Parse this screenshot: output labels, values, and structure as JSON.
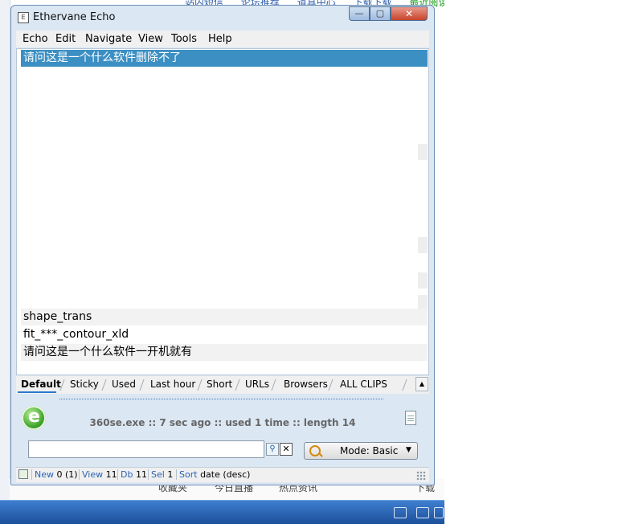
{
  "background": {
    "top_nav": [
      "站内短信",
      "论坛推荐",
      "道具中心",
      "下载下载",
      "最近阅读"
    ],
    "taskbar_items": [
      "收藏夹",
      "今日直播",
      "热点资讯",
      "下载"
    ]
  },
  "window": {
    "title": "Ethervane Echo",
    "controls": {
      "minimize": "—",
      "maximize": "▢",
      "close": "✕"
    }
  },
  "menu": [
    "Echo",
    "Edit",
    "Navigate",
    "View",
    "Tools",
    "Help"
  ],
  "clips": {
    "selected": "请问这是一个什么软件删除不了",
    "items": [
      "shape_trans",
      "fit_***_contour_xld",
      "请问这是一个什么软件一开机就有"
    ]
  },
  "tabs": [
    "Default",
    "Sticky",
    "Used",
    "Last hour",
    "Short",
    "URLs",
    "Browsers",
    "ALL CLIPS"
  ],
  "active_tab": "Default",
  "info": {
    "text": "360se.exe :: 7 sec ago :: used 1 time :: length 14"
  },
  "search": {
    "value": "",
    "mode_label": "Mode: Basic"
  },
  "status": {
    "new": {
      "label": "New",
      "value": "0 (1)"
    },
    "view": {
      "label": "View",
      "value": "11"
    },
    "db": {
      "label": "Db",
      "value": "11"
    },
    "sel": {
      "label": "Sel",
      "value": "1"
    },
    "sort": {
      "label": "Sort",
      "value": "date (desc)"
    }
  },
  "colors": {
    "selection": "#3b8fc3",
    "link_blue": "#2a62b5",
    "window_frame": "#dbe7f3"
  }
}
